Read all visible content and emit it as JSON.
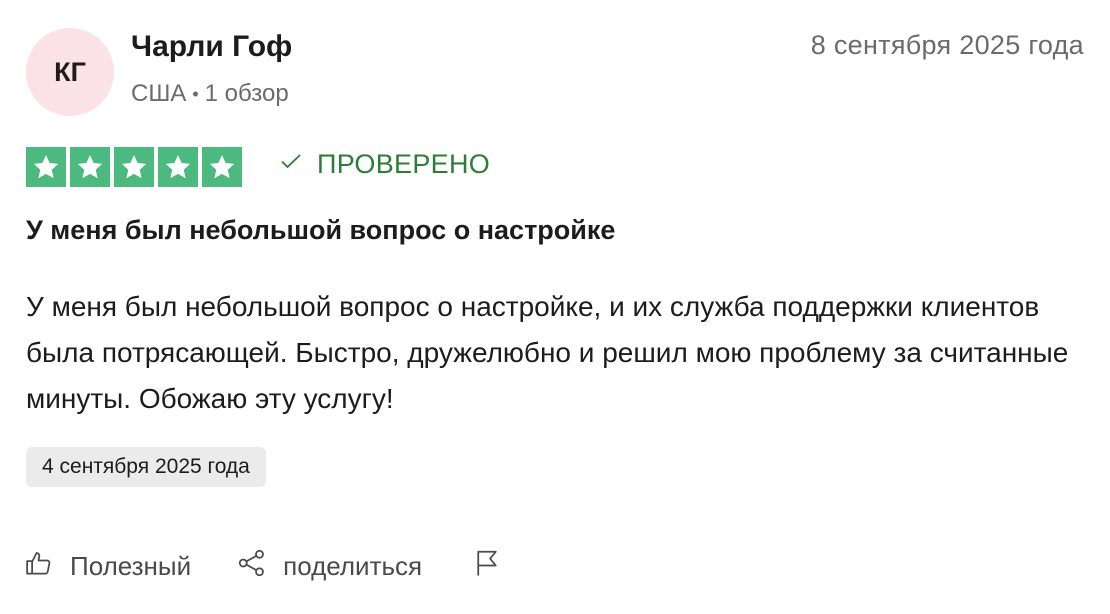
{
  "reviewer": {
    "initials": "КГ",
    "name": "Чарли Гоф",
    "country": "США",
    "separator": "•",
    "reviews_count": "1 обзор"
  },
  "review": {
    "published_date": "8 сентября 2025 года",
    "rating": 5,
    "rating_max": 5,
    "verified_label": "ПРОВЕРЕНО",
    "title": "У меня был небольшой вопрос о настройке",
    "body": "У меня был небольшой вопрос о настройке, и их служба поддержки клиентов была потрясающей. Быстро, дружелюбно и решил мою проблему за считанные минуты. Обожаю эту услугу!",
    "experience_date": "4 сентября 2025 года"
  },
  "actions": {
    "useful_label": "Полезный",
    "share_label": "поделиться",
    "flag_icon": "flag-icon"
  },
  "colors": {
    "star_green": "#4cb97f",
    "verified_green": "#2e7d36",
    "avatar_bg": "#fbe1e8",
    "date_chip_bg": "#ebebeb"
  }
}
